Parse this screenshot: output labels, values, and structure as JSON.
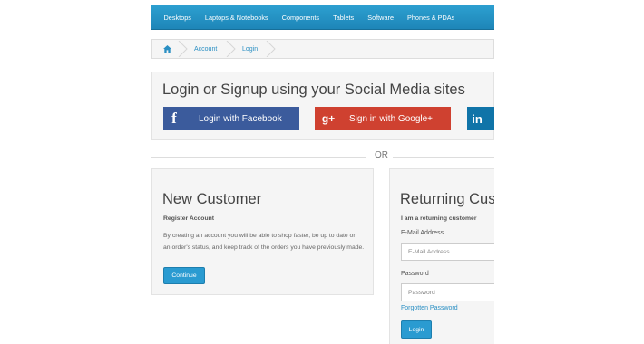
{
  "nav": {
    "items": [
      "Desktops",
      "Laptops & Notebooks",
      "Components",
      "Tablets",
      "Software",
      "Phones & PDAs"
    ]
  },
  "breadcrumb": {
    "home_icon": "home-icon",
    "items": [
      "Account",
      "Login"
    ]
  },
  "social": {
    "title": "Login or Signup using your Social Media sites",
    "facebook": {
      "icon": "f",
      "label": "Login with Facebook"
    },
    "google": {
      "icon": "g+",
      "label": "Sign in with Google+"
    },
    "linkedin": {
      "icon": "in"
    }
  },
  "divider": {
    "text": "OR"
  },
  "new_customer": {
    "title": "New Customer",
    "subtitle": "Register Account",
    "text": "By creating an account you will be able to shop faster, be up to date on an order's status, and keep track of the orders you have previously made.",
    "button": "Continue"
  },
  "returning_customer": {
    "title": "Returning Customer",
    "subtitle": "I am a returning customer",
    "email_label": "E-Mail Address",
    "email_placeholder": "E-Mail Address",
    "password_label": "Password",
    "password_placeholder": "Password",
    "forgot": "Forgotten Password",
    "button": "Login"
  },
  "colors": {
    "nav": "#229ad0",
    "facebook": "#3b5b9c",
    "google": "#cf4130",
    "linkedin": "#1074a8",
    "button": "#2a9bd1",
    "link": "#2a8fc3"
  }
}
